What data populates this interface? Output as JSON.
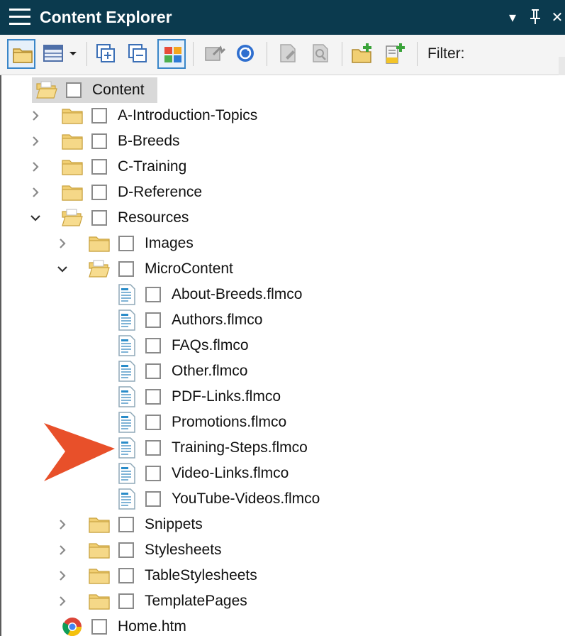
{
  "window": {
    "title": "Content Explorer",
    "controls": {
      "dropdown_glyph": "▾",
      "pin_glyph": "ꟼ",
      "close_glyph": "✕"
    }
  },
  "toolbar": {
    "buttons": [
      {
        "name": "open-folder-icon",
        "active": true
      },
      {
        "name": "view-layout-icon",
        "active": false,
        "has_dropdown": true
      },
      {
        "name": "expand-all-icon",
        "active": false
      },
      {
        "name": "collapse-all-icon",
        "active": false
      },
      {
        "name": "color-grid-icon",
        "active": true
      },
      {
        "name": "publish-icon",
        "active": false,
        "disabled": true
      },
      {
        "name": "refresh-icon",
        "active": false
      },
      {
        "name": "page-edit-icon",
        "active": false,
        "disabled": true
      },
      {
        "name": "page-search-icon",
        "active": false,
        "disabled": true
      },
      {
        "name": "new-folder-icon",
        "active": false
      },
      {
        "name": "new-file-icon",
        "active": false
      }
    ],
    "filter_label": "Filter:"
  },
  "tree": [
    {
      "label": "Content",
      "type": "folder-open",
      "depth": 0,
      "expander": "none",
      "selected": true
    },
    {
      "label": "A-Introduction-Topics",
      "type": "folder",
      "depth": 1,
      "expander": "collapsed"
    },
    {
      "label": "B-Breeds",
      "type": "folder",
      "depth": 1,
      "expander": "collapsed"
    },
    {
      "label": "C-Training",
      "type": "folder",
      "depth": 1,
      "expander": "collapsed"
    },
    {
      "label": "D-Reference",
      "type": "folder",
      "depth": 1,
      "expander": "collapsed"
    },
    {
      "label": "Resources",
      "type": "folder-open",
      "depth": 1,
      "expander": "expanded"
    },
    {
      "label": "Images",
      "type": "folder",
      "depth": 2,
      "expander": "collapsed"
    },
    {
      "label": "MicroContent",
      "type": "folder-open",
      "depth": 2,
      "expander": "expanded"
    },
    {
      "label": "About-Breeds.flmco",
      "type": "file",
      "depth": 3,
      "expander": "none"
    },
    {
      "label": "Authors.flmco",
      "type": "file",
      "depth": 3,
      "expander": "none"
    },
    {
      "label": "FAQs.flmco",
      "type": "file",
      "depth": 3,
      "expander": "none"
    },
    {
      "label": "Other.flmco",
      "type": "file",
      "depth": 3,
      "expander": "none"
    },
    {
      "label": "PDF-Links.flmco",
      "type": "file",
      "depth": 3,
      "expander": "none"
    },
    {
      "label": "Promotions.flmco",
      "type": "file",
      "depth": 3,
      "expander": "none"
    },
    {
      "label": "Training-Steps.flmco",
      "type": "file",
      "depth": 3,
      "expander": "none"
    },
    {
      "label": "Video-Links.flmco",
      "type": "file",
      "depth": 3,
      "expander": "none"
    },
    {
      "label": "YouTube-Videos.flmco",
      "type": "file",
      "depth": 3,
      "expander": "none"
    },
    {
      "label": "Snippets",
      "type": "folder",
      "depth": 2,
      "expander": "collapsed"
    },
    {
      "label": "Stylesheets",
      "type": "folder",
      "depth": 2,
      "expander": "collapsed"
    },
    {
      "label": "TableStylesheets",
      "type": "folder",
      "depth": 2,
      "expander": "collapsed"
    },
    {
      "label": "TemplatePages",
      "type": "folder",
      "depth": 2,
      "expander": "collapsed"
    },
    {
      "label": "Home.htm",
      "type": "chrome-file",
      "depth": 1,
      "expander": "none"
    }
  ],
  "annotation": {
    "pointer_icon": "orange-arrow-icon",
    "points_to": "Training-Steps.flmco",
    "color": "#e8502a"
  },
  "colors": {
    "titlebar": "#0b3a4e",
    "folder": "#f1cf73",
    "active_border": "#3a86c8",
    "selection": "#d9d9d9"
  }
}
